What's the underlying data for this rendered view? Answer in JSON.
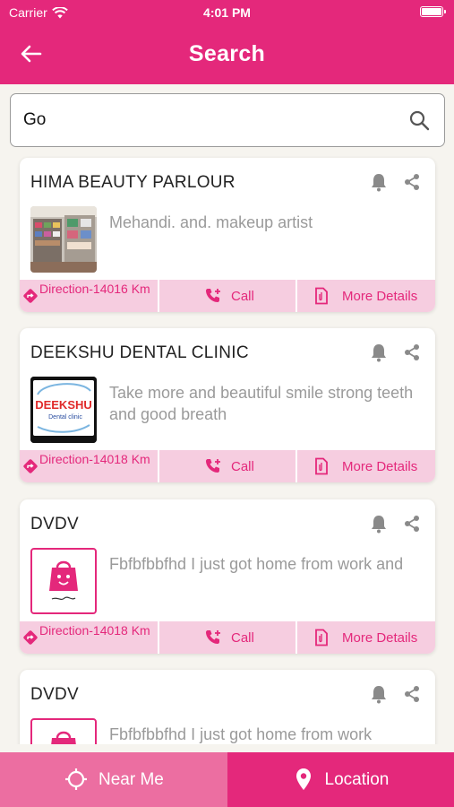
{
  "status_bar": {
    "carrier": "Carrier",
    "time": "4:01 PM"
  },
  "nav": {
    "title": "Search"
  },
  "search": {
    "value": "Go"
  },
  "results": [
    {
      "title": "HIMA BEAUTY PARLOUR",
      "description": "Mehandi. and. makeup artist",
      "thumb": "shop-photo",
      "direction": "Direction-14016 Km",
      "call": "Call",
      "more": "More Details"
    },
    {
      "title": "DEEKSHU DENTAL CLINIC",
      "description": "Take more and beautiful smile strong teeth and good breath",
      "thumb": "dental-logo",
      "logo_text": "DEEKSHU",
      "logo_sub": "Dental clinic",
      "direction": "Direction-14018 Km",
      "call": "Call",
      "more": "More Details"
    },
    {
      "title": "DVDV",
      "description": "Fbfbfbbfhd I just got home from work and",
      "thumb": "bag-logo",
      "direction": "Direction-14018 Km",
      "call": "Call",
      "more": "More Details"
    },
    {
      "title": "DVDV",
      "description": "Fbfbfbbfhd I just got home from work",
      "thumb": "bag-logo"
    }
  ],
  "tabs": {
    "near_me": "Near Me",
    "location": "Location"
  },
  "colors": {
    "primary": "#e4287b",
    "secondary": "#ec6ea1",
    "action_bg": "#f6cde0"
  }
}
